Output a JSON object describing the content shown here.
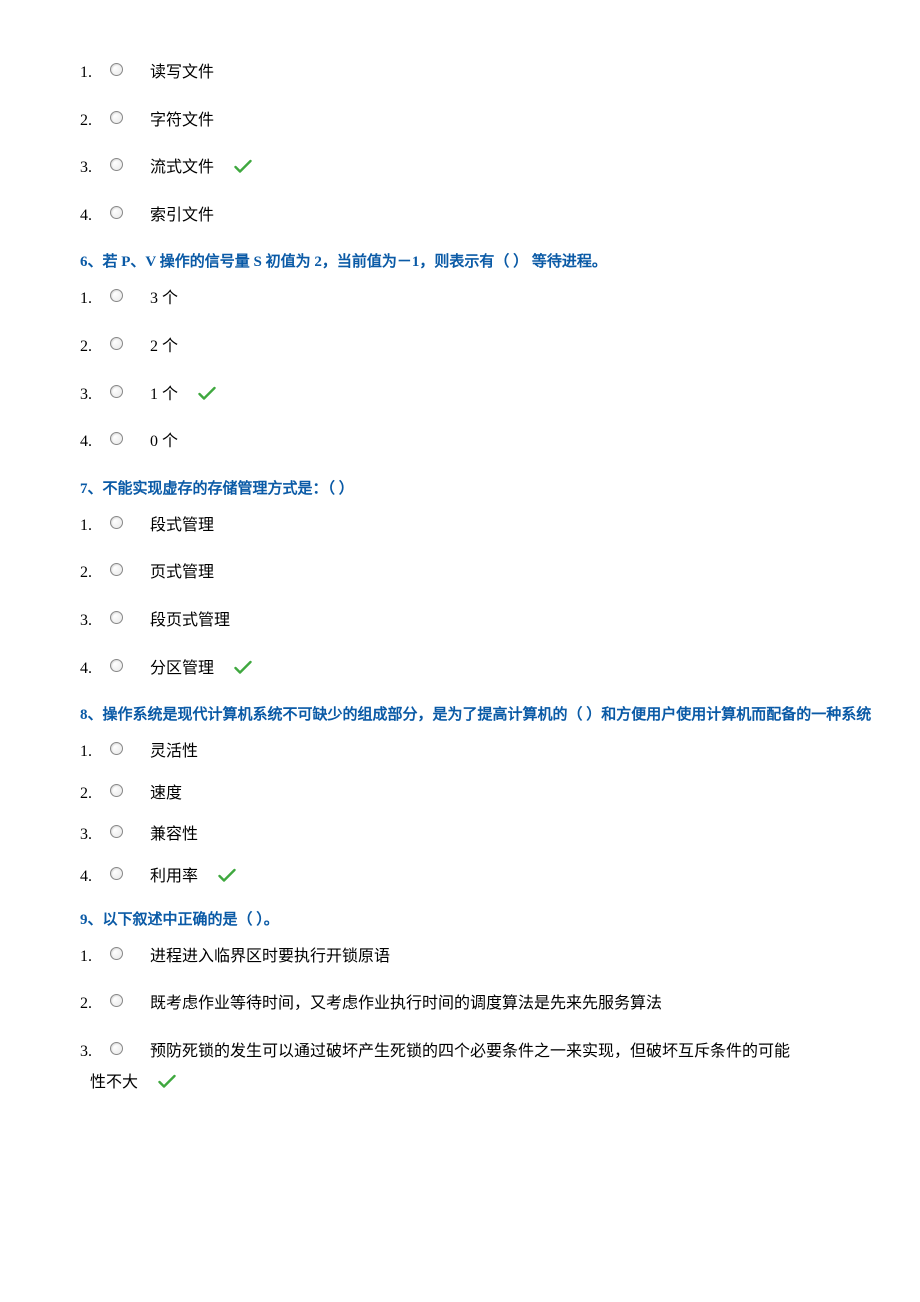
{
  "q5": {
    "options": [
      {
        "num": "1.",
        "text": "读写文件",
        "correct": false
      },
      {
        "num": "2.",
        "text": "字符文件",
        "correct": false
      },
      {
        "num": "3.",
        "text": "流式文件",
        "correct": true
      },
      {
        "num": "4.",
        "text": "索引文件",
        "correct": false
      }
    ]
  },
  "q6": {
    "title": "6、若 P、V 操作的信号量 S 初值为 2，当前值为－1，则表示有（ ）  等待进程。",
    "options": [
      {
        "num": "1.",
        "text": "3 个",
        "correct": false
      },
      {
        "num": "2.",
        "text": "2 个",
        "correct": false
      },
      {
        "num": "3.",
        "text": "1 个",
        "correct": true
      },
      {
        "num": "4.",
        "text": "0 个",
        "correct": false
      }
    ]
  },
  "q7": {
    "title": "7、不能实现虚存的存储管理方式是：（        ）",
    "options": [
      {
        "num": "1.",
        "text": "段式管理",
        "correct": false
      },
      {
        "num": "2.",
        "text": "页式管理",
        "correct": false
      },
      {
        "num": "3.",
        "text": "段页式管理",
        "correct": false
      },
      {
        "num": "4.",
        "text": "分区管理",
        "correct": true
      }
    ]
  },
  "q8": {
    "title": "8、操作系统是现代计算机系统不可缺少的组成部分，是为了提高计算机的（ ）和方便用户使用计算机而配备的一种系统",
    "options": [
      {
        "num": "1.",
        "text": "灵活性",
        "correct": false
      },
      {
        "num": "2.",
        "text": "速度",
        "correct": false
      },
      {
        "num": "3.",
        "text": "兼容性",
        "correct": false
      },
      {
        "num": "4.",
        "text": "利用率",
        "correct": true
      }
    ]
  },
  "q9": {
    "title": "9、以下叙述中正确的是（ ）。",
    "options": [
      {
        "num": "1.",
        "text": "进程进入临界区时要执行开锁原语",
        "correct": false
      },
      {
        "num": "2.",
        "text": "既考虑作业等待时间，又考虑作业执行时间的调度算法是先来先服务算法",
        "correct": false
      },
      {
        "num": "3.",
        "text": "预防死锁的发生可以通过破坏产生死锁的四个必要条件之一来实现，但破坏互斥条件的可能",
        "cont": "性不大",
        "correct": true
      }
    ]
  }
}
